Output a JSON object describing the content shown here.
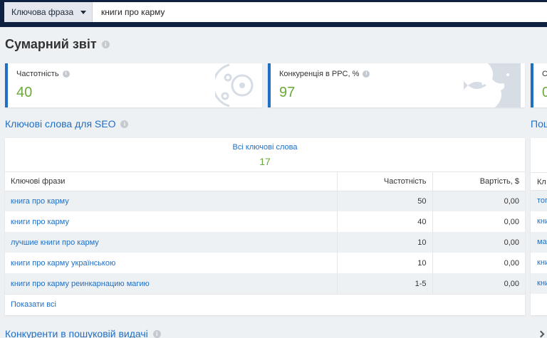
{
  "search": {
    "mode_label": "Ключова фраза",
    "query": "книги про карму"
  },
  "page_title": "Сумарний звіт",
  "cards": [
    {
      "label": "Частотність",
      "value": "40",
      "icon": "target-icon"
    },
    {
      "label": "Конкуренція в PPC, %",
      "value": "97",
      "icon": "fish-icon"
    },
    {
      "label": "С",
      "value": "0"
    }
  ],
  "seo": {
    "title": "Ключові слова для SEO",
    "all_keywords_label": "Всі ключові слова",
    "all_keywords_count": "17",
    "columns": [
      "Ключові фрази",
      "Частотність",
      "Вартість, $"
    ],
    "rows": [
      {
        "phrase": "книга про карму",
        "freq": "50",
        "cost": "0,00"
      },
      {
        "phrase": "книги про карму",
        "freq": "40",
        "cost": "0,00"
      },
      {
        "phrase": "лучшие книги про карму",
        "freq": "10",
        "cost": "0,00"
      },
      {
        "phrase": "книги про карму українською",
        "freq": "10",
        "cost": "0,00"
      },
      {
        "phrase": "книги про карму реинкарнацию магию",
        "freq": "1-5",
        "cost": "0,00"
      }
    ],
    "show_all": "Показати всі"
  },
  "side_section": {
    "title": "Пош",
    "header": "Кл",
    "rows": [
      "топ",
      "кни",
      "ма",
      "кни",
      "кни"
    ]
  },
  "competitors": {
    "title": "Конкуренти в пошуковій видачі"
  },
  "colors": {
    "accent": "#1f6fc5",
    "value_green": "#6aaa3a",
    "topbar": "#0f2140"
  }
}
